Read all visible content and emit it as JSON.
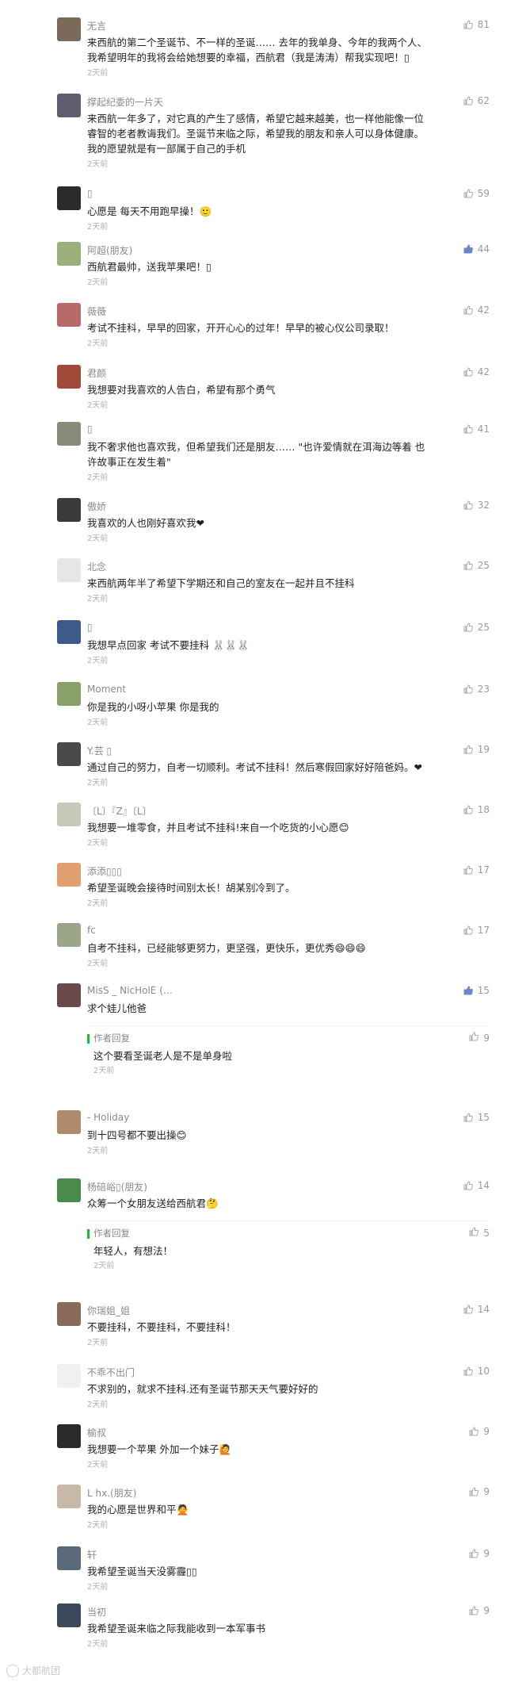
{
  "colors": {
    "accent": "#2bb24c",
    "text": "#222222",
    "meta": "#8a8a8a",
    "time": "#b0b0b0",
    "like_active": "#6a88c9"
  },
  "comments": [
    {
      "name": "无言",
      "likes": "81",
      "liked": false,
      "avatar": "#7b6a5a",
      "lines": [
        "来西航的第二个圣诞节、不一样的圣诞…… 去年的我单身、今年的我两个人、",
        "我希望明年的我将会给她想要的幸福，西航君（我是涛涛）帮我实现吧！▯"
      ],
      "time": "2天前"
    },
    {
      "name": "撑起纪委的一片天",
      "likes": "62",
      "liked": false,
      "avatar": "#5e5e6e",
      "lines": [
        "来西航一年多了，对它真的产生了感情，希望它越来越美，也一样他能像一位",
        "睿智的老者教诲我们。圣诞节来临之际，希望我的朋友和亲人可以身体健康。",
        "我的愿望就是有一部属于自己的手机"
      ],
      "time": "2天前"
    },
    {
      "name": "▯",
      "likes": "59",
      "liked": false,
      "avatar": "#2b2b2b",
      "lines": [
        "心愿是 每天不用跑早操！🙂"
      ],
      "time": "2天前"
    },
    {
      "name": "阿超(朋友)",
      "likes": "44",
      "liked": true,
      "avatar": "#9bb07a",
      "lines": [
        "西航君最帅，送我苹果吧！▯"
      ],
      "time": "2天前"
    },
    {
      "name": "薇薇",
      "likes": "42",
      "liked": false,
      "avatar": "#b86a6a",
      "lines": [
        "考试不挂科，早早的回家，开开心心的过年！早早的被心仪公司录取！"
      ],
      "time": "2天前"
    },
    {
      "name": "君颜",
      "likes": "42",
      "liked": false,
      "avatar": "#a24a3a",
      "lines": [
        "我想要对我喜欢的人告白，希望有那个勇气"
      ],
      "time": "2天前"
    },
    {
      "name": "▯",
      "likes": "41",
      "liked": false,
      "avatar": "#8a8a7a",
      "lines": [
        "我不奢求他也喜欢我，但希望我们还是朋友……   \"也许爱情就在洱海边等着  也",
        "许故事正在发生着\""
      ],
      "time": "2天前"
    },
    {
      "name": "傲娇",
      "likes": "32",
      "liked": false,
      "avatar": "#3a3a3a",
      "lines": [
        "我喜欢的人也刚好喜欢我❤"
      ],
      "time": "2天前"
    },
    {
      "name": "北念",
      "likes": "25",
      "liked": false,
      "avatar": "#e6e6e6",
      "lines": [
        "来西航两年半了希望下学期还和自己的室友在一起并且不挂科"
      ],
      "time": "2天前"
    },
    {
      "name": "▯",
      "likes": "25",
      "liked": false,
      "avatar": "#3d5a8a",
      "lines": [
        "我想早点回家 考试不要挂科 🐰🐰🐰"
      ],
      "time": "2天前"
    },
    {
      "name": "Moment",
      "likes": "23",
      "liked": false,
      "avatar": "#8aa06a",
      "lines": [
        "你是我的小呀小苹果 你是我的"
      ],
      "time": "2天前"
    },
    {
      "name": "Y.芸 ▯",
      "likes": "19",
      "liked": false,
      "avatar": "#4a4a4a",
      "lines": [
        "通过自己的努力，自考一切顺利。考试不挂科！然后寒假回家好好陪爸妈。❤"
      ],
      "time": "2天前"
    },
    {
      "name": "〔L〕『Z』〔L〕",
      "likes": "18",
      "liked": false,
      "avatar": "#c8c8b8",
      "lines": [
        "我想要一堆零食，并且考试不挂科!来自一个吃货的小心愿😊"
      ],
      "time": "2天前"
    },
    {
      "name": "添添▯▯▯",
      "likes": "17",
      "liked": false,
      "avatar": "#e0a070",
      "lines": [
        "希望圣诞晚会接待时间别太长！胡某别冷到了。"
      ],
      "time": "2天前"
    },
    {
      "name": "fc",
      "likes": "17",
      "liked": false,
      "avatar": "#9aa58a",
      "lines": [
        "自考不挂科，已经能够更努力，更坚强，更快乐，更优秀😄😄😄"
      ],
      "time": "2天前"
    },
    {
      "name": "MisS _ NicHolE (…",
      "likes": "15",
      "liked": true,
      "avatar": "#6a4a4a",
      "lines": [
        "求个娃儿他爸"
      ],
      "time": "",
      "reply": {
        "label": "作者回复",
        "likes": "9",
        "text": "这个要看圣诞老人是不是单身啦",
        "time": "2天前"
      }
    },
    {
      "name": "- Holiday",
      "likes": "15",
      "liked": false,
      "avatar": "#b08a6a",
      "lines": [
        "到十四号都不要出操😊"
      ],
      "time": "2天前"
    },
    {
      "name": "杨碚峪▯(朋友)",
      "likes": "14",
      "liked": false,
      "avatar": "#4a8a4a",
      "lines": [
        "众筹一个女朋友送给西航君🤔"
      ],
      "time": "",
      "reply": {
        "label": "作者回复",
        "likes": "5",
        "text": "年轻人，有想法！",
        "time": "2天前"
      }
    },
    {
      "name": "你瑞姐_姐",
      "likes": "14",
      "liked": false,
      "avatar": "#8a6a5a",
      "lines": [
        "不要挂科，不要挂科，不要挂科！"
      ],
      "time": "2天前"
    },
    {
      "name": "不乖不出门",
      "likes": "10",
      "liked": false,
      "avatar": "#f0f0f0",
      "lines": [
        "不求别的，就求不挂科.还有圣诞节那天天气要好好的"
      ],
      "time": "2天前"
    },
    {
      "name": "榆叔",
      "likes": "9",
      "liked": false,
      "avatar": "#2a2a2a",
      "lines": [
        "我想要一个苹果 外加一个妹子🙋"
      ],
      "time": "2天前"
    },
    {
      "name": "L hx.(朋友)",
      "likes": "9",
      "liked": false,
      "avatar": "#c8b8a8",
      "lines": [
        "我的心愿是世界和平🙅"
      ],
      "time": "2天前"
    },
    {
      "name": "轩",
      "likes": "9",
      "liked": false,
      "avatar": "#5a6a7a",
      "lines": [
        "我希望圣诞当天没雾霾▯▯"
      ],
      "time": "2天前"
    },
    {
      "name": "当初",
      "likes": "9",
      "liked": false,
      "avatar": "#3a4a5a",
      "lines": [
        "我希望圣诞来临之际我能收到一本军事书"
      ],
      "time": "2天前"
    }
  ],
  "watermark": "大都航团"
}
